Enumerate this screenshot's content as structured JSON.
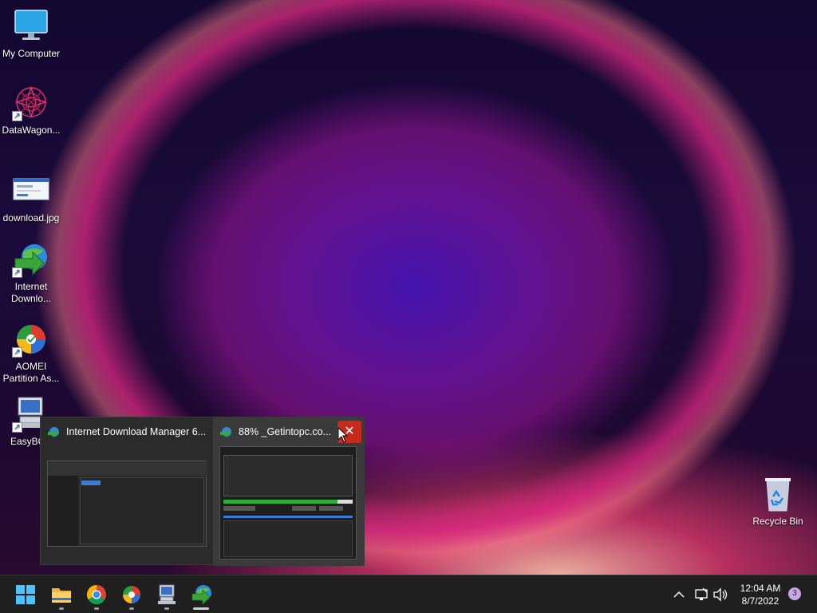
{
  "desktop": {
    "icons": [
      {
        "label": "My Computer",
        "icon": "computer-icon",
        "shortcut": false
      },
      {
        "label": "DataWagon...",
        "icon": "datawagon-icon",
        "shortcut": true
      },
      {
        "label": "download.jpg",
        "icon": "image-file-icon",
        "shortcut": false
      },
      {
        "label": "Internet Downlo...",
        "icon": "idm-icon",
        "shortcut": true
      },
      {
        "label": "AOMEI Partition As...",
        "icon": "aomei-icon",
        "shortcut": true
      },
      {
        "label": "EasyBCD",
        "icon": "easybcd-icon",
        "shortcut": true
      },
      {
        "label": "Recycle Bin",
        "icon": "recycle-bin-icon",
        "shortcut": false
      }
    ]
  },
  "preview": {
    "windows": [
      {
        "title": "Internet Download Manager 6....",
        "icon": "idm-icon"
      },
      {
        "title": "88% _Getintopc.co...",
        "icon": "idm-icon"
      }
    ],
    "close_label": "✕",
    "download_progress_percent": 88
  },
  "taskbar": {
    "apps": [
      {
        "name": "start",
        "icon": "windows-start-icon",
        "running": false
      },
      {
        "name": "file-explorer",
        "icon": "folder-icon",
        "running": true
      },
      {
        "name": "chrome",
        "icon": "chrome-icon",
        "running": true
      },
      {
        "name": "aomei",
        "icon": "aomei-icon",
        "running": true
      },
      {
        "name": "easybcd",
        "icon": "easybcd-icon",
        "running": true
      },
      {
        "name": "idm",
        "icon": "idm-icon",
        "running": true,
        "active": true
      }
    ],
    "tray": {
      "chevron": "^",
      "time": "12:04 AM",
      "date": "8/7/2022",
      "notifications": "3"
    }
  }
}
